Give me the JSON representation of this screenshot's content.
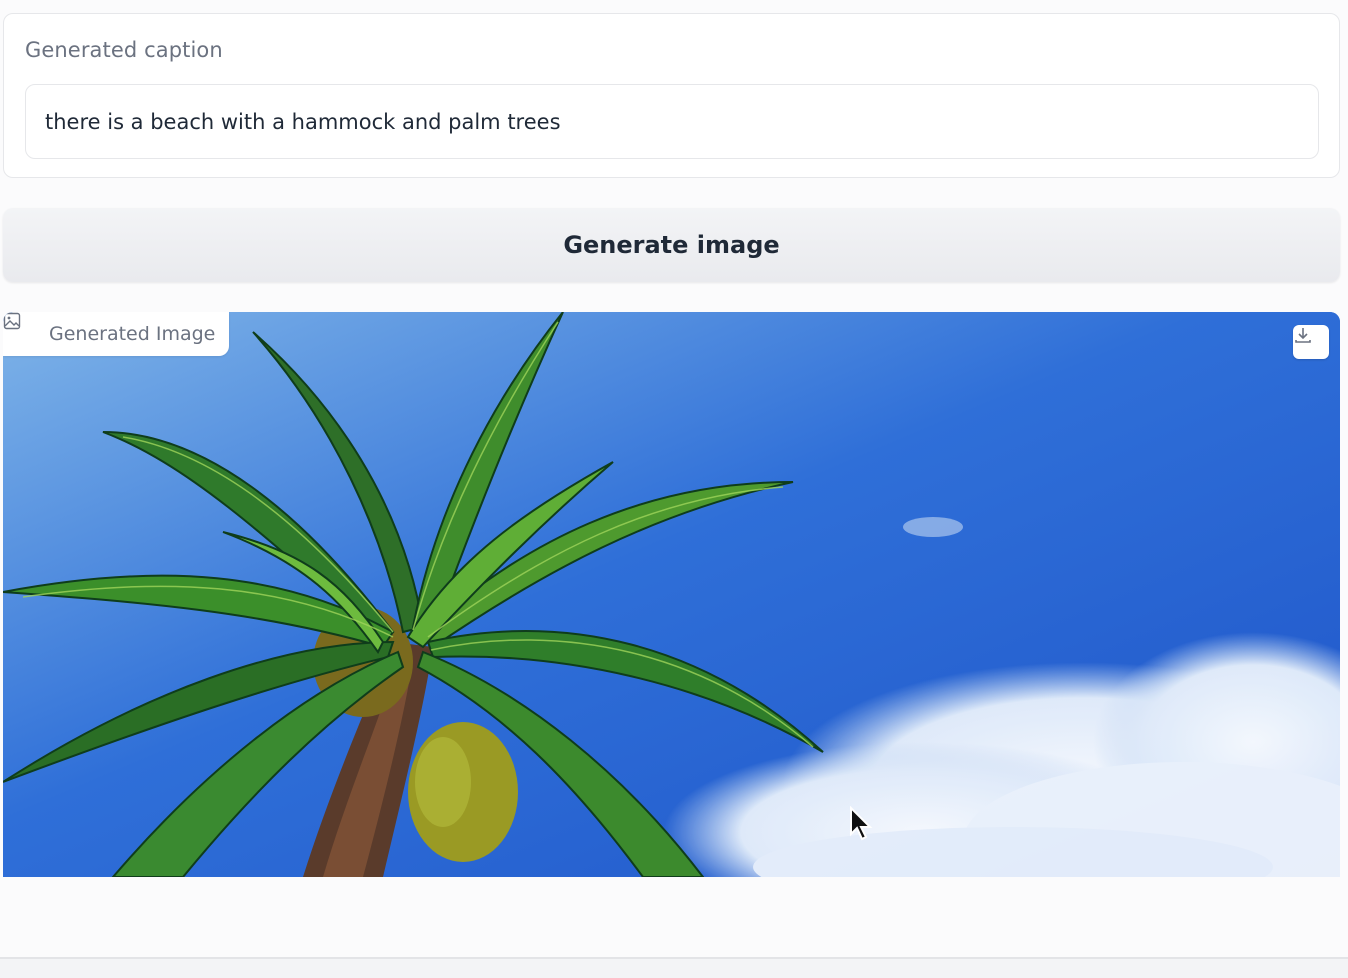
{
  "caption": {
    "label": "Generated caption",
    "value": "there is a beach with a hammock and palm trees"
  },
  "actions": {
    "generate_label": "Generate image"
  },
  "image_output": {
    "label": "Generated Image",
    "label_icon": "image-icon",
    "download_icon": "download-icon"
  },
  "colors": {
    "sky": "#2b63d4",
    "button_bg": "#eeeff2",
    "text_primary": "#1f2937",
    "text_muted": "#6b7280"
  }
}
